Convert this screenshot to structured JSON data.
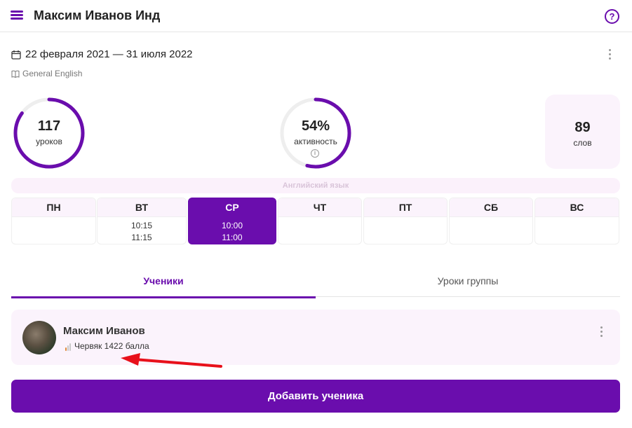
{
  "header": {
    "title": "Максим Иванов Инд",
    "menu_icon": "menu-icon",
    "help_icon": "help-icon",
    "help_glyph": "?"
  },
  "course": {
    "date_range": "22 февраля 2021 — 31 июля 2022",
    "name": "General English",
    "calendar_icon": "calendar-icon",
    "book_icon": "book-icon"
  },
  "stats": {
    "lessons": {
      "value": "117",
      "label": "уроков",
      "progress": 0.85
    },
    "activity": {
      "value": "54%",
      "label": "активность",
      "progress": 0.54,
      "info_glyph": "i"
    },
    "words": {
      "value": "89",
      "label": "слов"
    }
  },
  "schedule": {
    "language": "Английский язык",
    "days": [
      {
        "label": "ПН",
        "start": "",
        "end": "",
        "active": false
      },
      {
        "label": "ВТ",
        "start": "10:15",
        "end": "11:15",
        "active": false
      },
      {
        "label": "СР",
        "start": "10:00",
        "end": "11:00",
        "active": true
      },
      {
        "label": "ЧТ",
        "start": "",
        "end": "",
        "active": false
      },
      {
        "label": "ПТ",
        "start": "",
        "end": "",
        "active": false
      },
      {
        "label": "СБ",
        "start": "",
        "end": "",
        "active": false
      },
      {
        "label": "ВС",
        "start": "",
        "end": "",
        "active": false
      }
    ]
  },
  "tabs": [
    {
      "label": "Ученики",
      "active": true
    },
    {
      "label": "Уроки группы",
      "active": false
    }
  ],
  "students": [
    {
      "name": "Максим Иванов",
      "rank": "Червяк 1422 балла"
    }
  ],
  "actions": {
    "add_student": "Добавить ученика"
  },
  "colors": {
    "accent": "#6a0dad",
    "card_bg": "#fbf3fc",
    "annotation_arrow": "#e8101a",
    "rank_bars": [
      "#e08a3c",
      "#c9c9c9",
      "#c9c9c9"
    ]
  }
}
